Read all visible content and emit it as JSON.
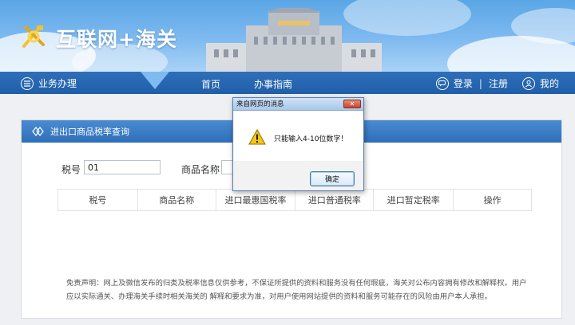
{
  "header": {
    "site_title": "互联网+海关"
  },
  "nav": {
    "menu_label": "业务办理",
    "links": [
      "首页",
      "办事指南"
    ],
    "login": "登录",
    "separator": "|",
    "register": "注册",
    "mine": "我的"
  },
  "panel": {
    "title": "进出口商品税率查询",
    "tariff_label": "税号",
    "tariff_value": "01",
    "name_label": "商品名称",
    "name_value": "",
    "columns": [
      "税号",
      "商品名称",
      "进口最惠国税率",
      "进口普通税率",
      "进口暂定税率",
      "操作"
    ],
    "disclaimer": "免责声明：网上及微信发布的归类及税率信息仅供参考，不保证所提供的资料和服务没有任何瑕疵，海关对公布内容拥有修改和解释权。用户应以实际通关、办理海关手续时相关海关的 解释和要求为准，对用户使用网站提供的资料和服务可能存在的风险由用户本人承担。"
  },
  "dialog": {
    "title": "来自网页的消息",
    "message": "只能输入4-10位数字！",
    "ok_label": "确定",
    "close_glyph": "✕"
  },
  "colors": {
    "nav_blue": "#1f5ea8",
    "panel_head_blue": "#2f6fb9",
    "warning_yellow": "#f5c518"
  }
}
